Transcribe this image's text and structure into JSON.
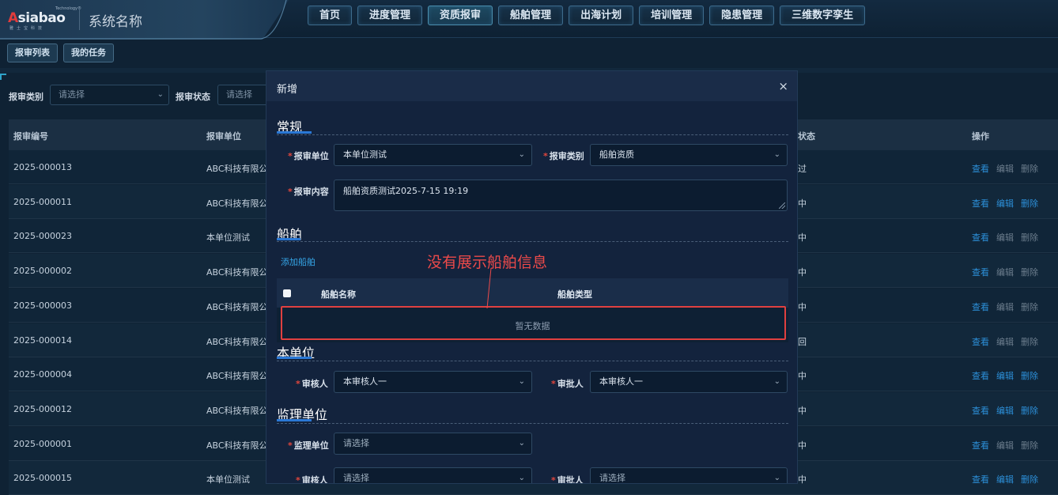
{
  "header": {
    "logo": {
      "tiny": "Technology®",
      "word_a": "A",
      "word_rest": "siabao",
      "sub": "雅士宝科技"
    },
    "system_name": "系统名称",
    "nav": [
      {
        "label": "首页"
      },
      {
        "label": "进度管理"
      },
      {
        "label": "资质报审"
      },
      {
        "label": "船舶管理"
      },
      {
        "label": "出海计划"
      },
      {
        "label": "培训管理"
      },
      {
        "label": "隐患管理"
      },
      {
        "label": "三维数字孪生"
      }
    ],
    "active_nav": "资质报审"
  },
  "subtabs": [
    {
      "label": "报审列表"
    },
    {
      "label": "我的任务"
    }
  ],
  "filters": {
    "category_label": "报审类别",
    "category_placeholder": "请选择",
    "status_label": "报审状态",
    "status_placeholder": "请选择"
  },
  "table": {
    "columns": {
      "number": "报审编号",
      "unit": "报审单位",
      "status": "状态",
      "actions": "操作"
    },
    "actions": {
      "view": "查看",
      "edit": "编辑",
      "delete": "删除"
    },
    "rows": [
      {
        "number": "2025-000013",
        "unit": "ABC科技有限公",
        "status": "过",
        "editable": false
      },
      {
        "number": "2025-000011",
        "unit": "ABC科技有限公",
        "status": "中",
        "editable": true
      },
      {
        "number": "2025-000023",
        "unit": "本单位测试",
        "status": "中",
        "editable": false
      },
      {
        "number": "2025-000002",
        "unit": "ABC科技有限公",
        "status": "中",
        "editable": false
      },
      {
        "number": "2025-000003",
        "unit": "ABC科技有限公",
        "status": "中",
        "editable": false
      },
      {
        "number": "2025-000014",
        "unit": "ABC科技有限公",
        "status": "回",
        "editable": false
      },
      {
        "number": "2025-000004",
        "unit": "ABC科技有限公",
        "status": "中",
        "editable": true
      },
      {
        "number": "2025-000012",
        "unit": "ABC科技有限公",
        "status": "中",
        "editable": true
      },
      {
        "number": "2025-000001",
        "unit": "ABC科技有限公",
        "status": "中",
        "editable": false
      },
      {
        "number": "2025-000015",
        "unit": "本单位测试",
        "status": "中",
        "editable": true
      }
    ]
  },
  "modal": {
    "title": "新增",
    "close_icon": "×",
    "sections": {
      "general": "常规",
      "ship": "船舶",
      "own_unit": "本单位",
      "supervision": "监理单位"
    },
    "fields": {
      "unit_label": "报审单位",
      "unit_value": "本单位测试",
      "category_label": "报审类别",
      "category_value": "船舶资质",
      "content_label": "报审内容",
      "content_value": "船舶资质测试2025-7-15 19:19",
      "reviewer_label": "审核人",
      "reviewer_value": "本审核人一",
      "approver_label": "审批人",
      "approver_value": "本审核人一",
      "supervisor_label": "监理单位",
      "supervisor_placeholder": "请选择",
      "sup_reviewer_label": "审核人",
      "sup_reviewer_placeholder": "请选择",
      "sup_approver_label": "审批人",
      "sup_approver_placeholder": "请选择"
    },
    "ship_table": {
      "add_link": "添加船舶",
      "col_name": "船舶名称",
      "col_type": "船舶类型",
      "empty_text": "暂无数据"
    },
    "annotation": {
      "text": "没有展示船舶信息",
      "color": "#ec4a4a"
    }
  },
  "colors": {
    "background": "#0f2234",
    "accent_blue": "#2c8fd8",
    "required_red": "#e2463d",
    "annotation_red": "#e04040"
  }
}
